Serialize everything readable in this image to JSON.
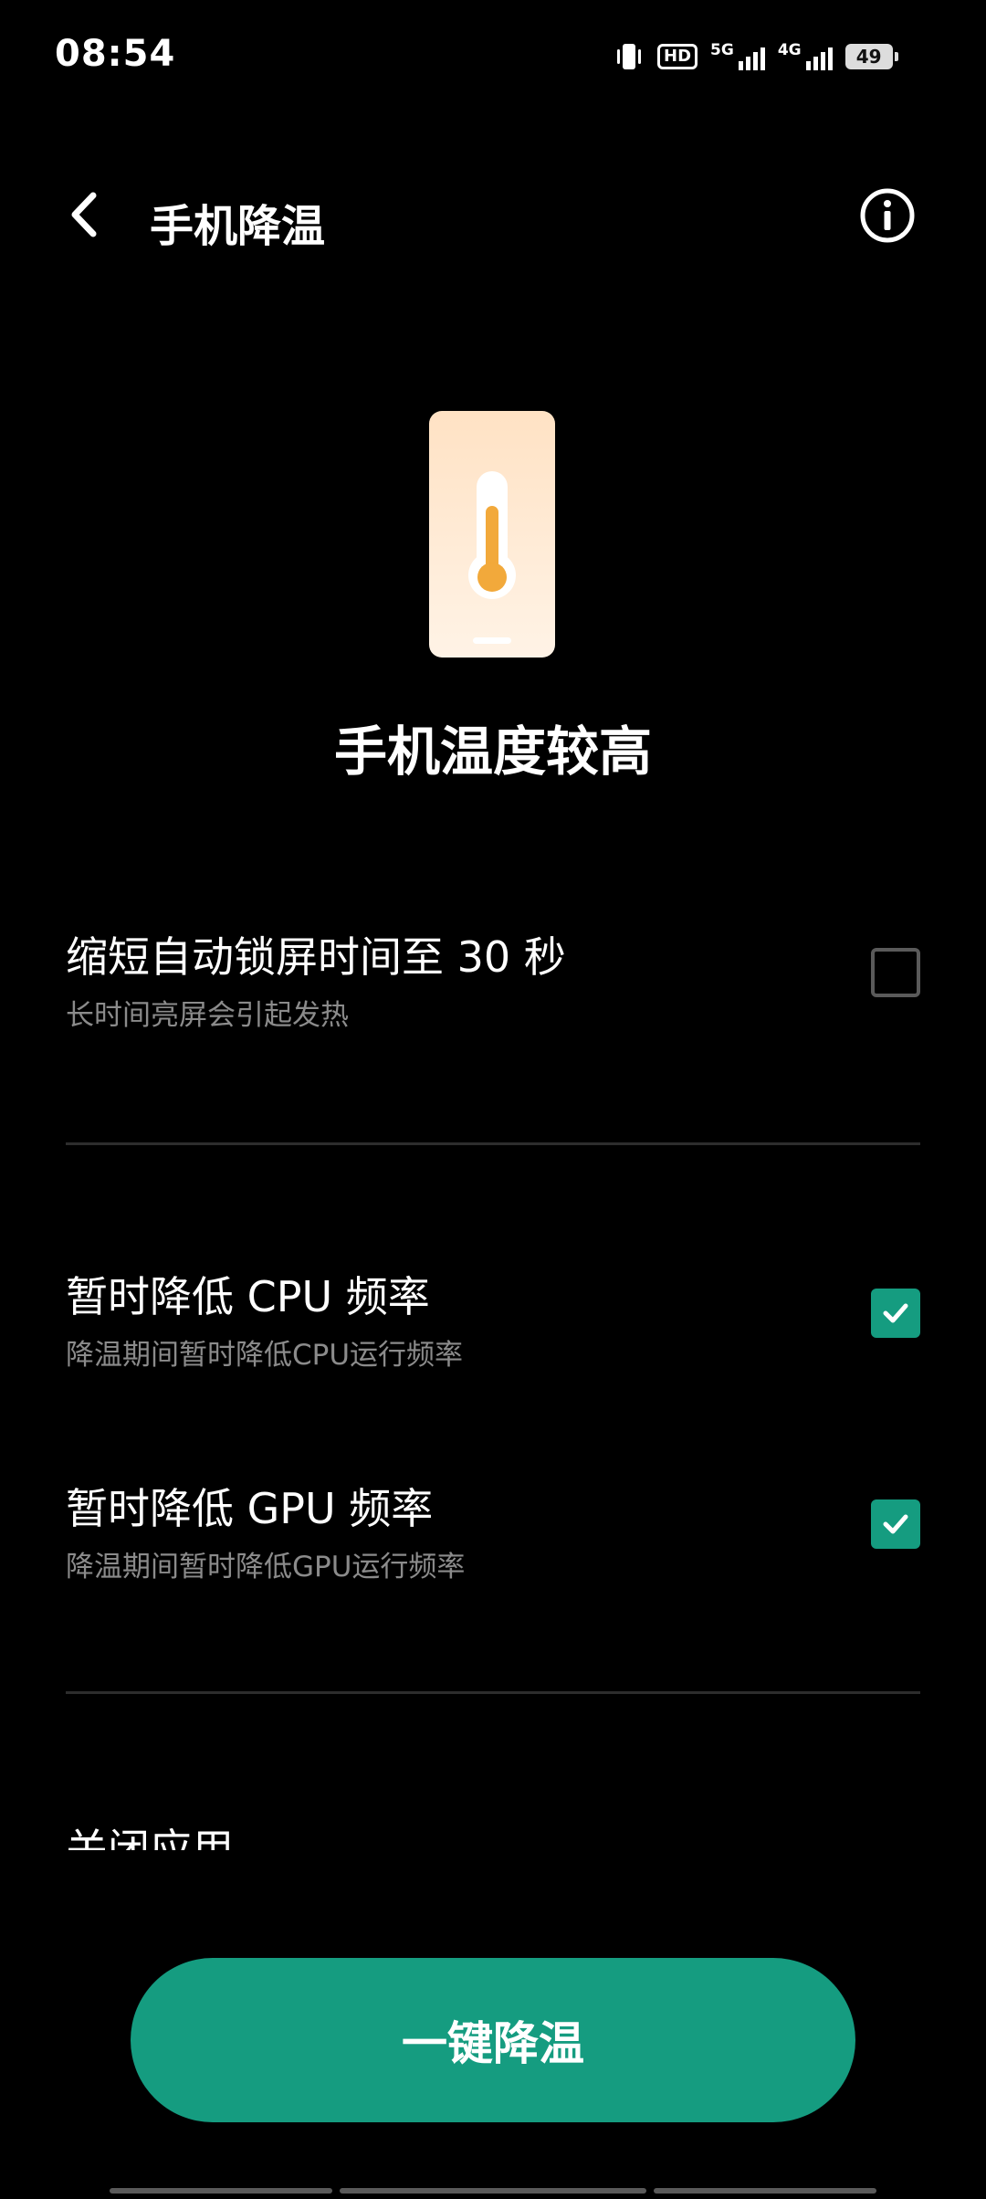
{
  "status_bar": {
    "time": "08:54",
    "icons": [
      "vibrate-icon",
      "hd-icon",
      "signal-5g-icon",
      "signal-4g-icon",
      "battery-icon"
    ],
    "hd_label": "HD",
    "net1": "5G",
    "net2": "4G",
    "battery_level": "49"
  },
  "header": {
    "title": "手机降温",
    "back_icon": "chevron-left-icon",
    "info_icon": "info-circle-icon"
  },
  "hero": {
    "icon": "thermometer-phone-icon",
    "title": "手机温度较高"
  },
  "options": [
    {
      "title": "缩短自动锁屏时间至 30 秒",
      "subtitle": "长时间亮屏会引起发热",
      "checked": false
    },
    {
      "title": "暂时降低 CPU 频率",
      "subtitle": "降温期间暂时降低CPU运行频率",
      "checked": true
    },
    {
      "title": "暂时降低 GPU 频率",
      "subtitle": "降温期间暂时降低GPU运行频率",
      "checked": true
    }
  ],
  "section": {
    "close_apps_label": "关闭应用"
  },
  "action": {
    "button_label": "一键降温"
  },
  "colors": {
    "accent": "#159c80",
    "background": "#000000",
    "subtext": "#8b8b8b"
  }
}
